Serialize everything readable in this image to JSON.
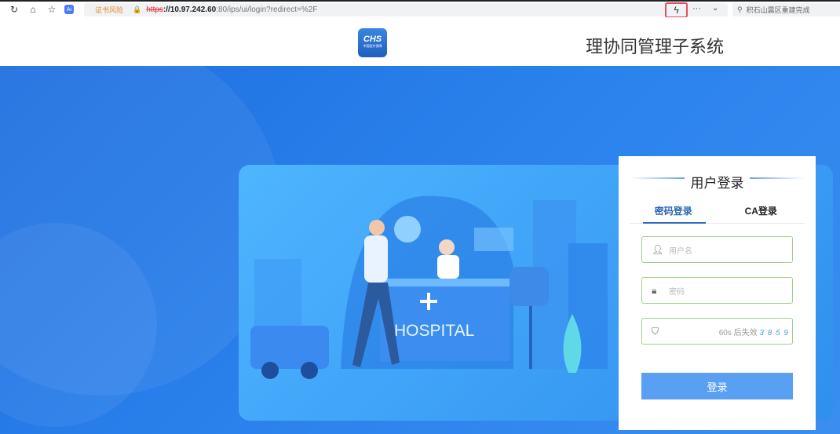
{
  "browser": {
    "cert_warning": "证书风险",
    "url_scheme": "https",
    "url_host": "://10.97.242.60",
    "url_rest": ":80/ips/ui/login?redirect=%2F",
    "search_text": "积石山震区重建完成"
  },
  "header": {
    "logo_text": "CHS",
    "logo_subtext": "中国医疗保障",
    "title": "理协同管理子系统"
  },
  "illustration": {
    "sign": "HOSPITAL"
  },
  "login": {
    "title": "用户登录",
    "tabs": [
      {
        "label": "密码登录"
      },
      {
        "label": "CA登录"
      }
    ],
    "username_placeholder": "用户名",
    "password_placeholder": "密码",
    "captcha_hint": "60s 后失效",
    "captcha_code": "3 8 5 9",
    "submit": "登录"
  },
  "colors": {
    "accent": "#2866b4",
    "button": "#5aa0f2",
    "field_border": "#9fd08a"
  }
}
